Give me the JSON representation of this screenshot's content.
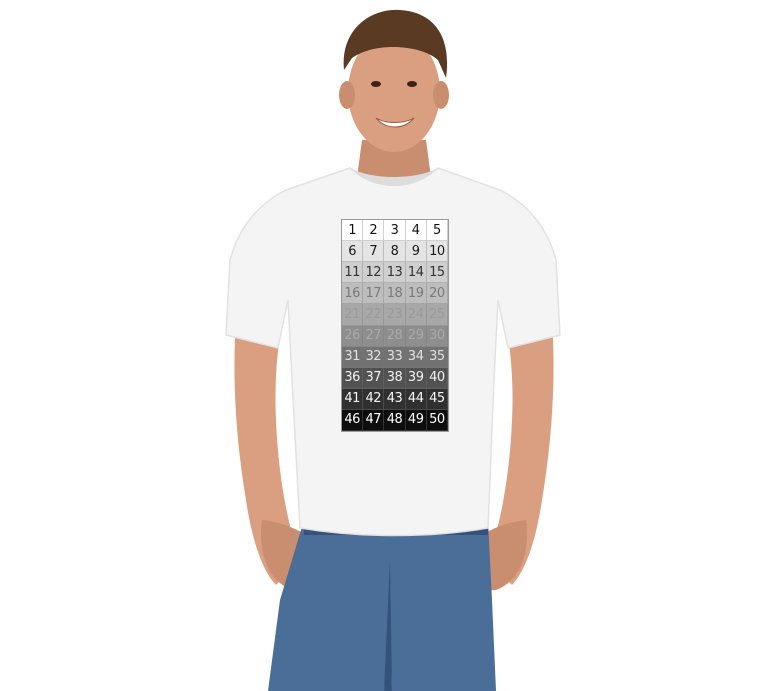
{
  "grid": {
    "numbers": [
      1,
      2,
      3,
      4,
      5,
      6,
      7,
      8,
      9,
      10,
      11,
      12,
      13,
      14,
      15,
      16,
      17,
      18,
      19,
      20,
      21,
      22,
      23,
      24,
      25,
      26,
      27,
      28,
      29,
      30,
      31,
      32,
      33,
      34,
      35,
      36,
      37,
      38,
      39,
      40,
      41,
      42,
      43,
      44,
      45,
      46,
      47,
      48,
      49,
      50
    ],
    "row_backgrounds": [
      "#ffffff",
      "#e4e4e4",
      "#cfcfcf",
      "#bdbdbd",
      "#a8a8a8",
      "#8e8e8e",
      "#727272",
      "#525252",
      "#303030",
      "#0d0d0d"
    ],
    "row_text_colors": [
      "#111111",
      "#1a1a1a",
      "#333333",
      "#7a7a7a",
      "#9b9b9b",
      "#aaaaaa",
      "#e0e0e0",
      "#f2f2f2",
      "#f5f5f5",
      "#ffffff"
    ]
  },
  "colors": {
    "skin": "#d99f80",
    "skin_shadow": "#bf8064",
    "hair": "#5a3a22",
    "shirt": "#f4f4f4",
    "shirt_shadow": "#dcdcdc",
    "jeans": "#4a6e98",
    "jeans_dark": "#34527a"
  }
}
